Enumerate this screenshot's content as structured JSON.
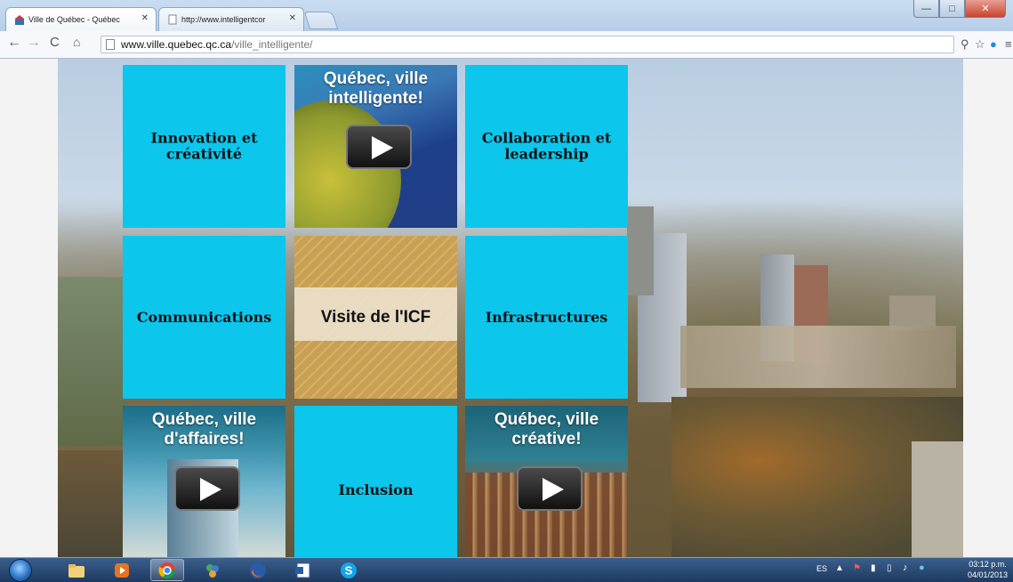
{
  "browser": {
    "tabs": [
      {
        "title": "Ville de Québec - Québec",
        "active": true
      },
      {
        "title": "http://www.intelligentcor",
        "active": false
      }
    ],
    "url_host": "www.ville.quebec.qc.ca",
    "url_path": "/ville_intelligente/"
  },
  "tiles": {
    "innovation": "Innovation et créativité",
    "video_smart": "Québec, ville intelligente!",
    "collaboration": "Collaboration et leadership",
    "communications": "Communications",
    "icf": "Visite de l'ICF",
    "infrastructures": "Infrastructures",
    "video_business": "Québec, ville d'affaires!",
    "inclusion": "Inclusion",
    "video_creative": "Québec, ville créative!"
  },
  "taskbar": {
    "language": "ES",
    "time": "03:12 p.m.",
    "date": "04/01/2013"
  }
}
